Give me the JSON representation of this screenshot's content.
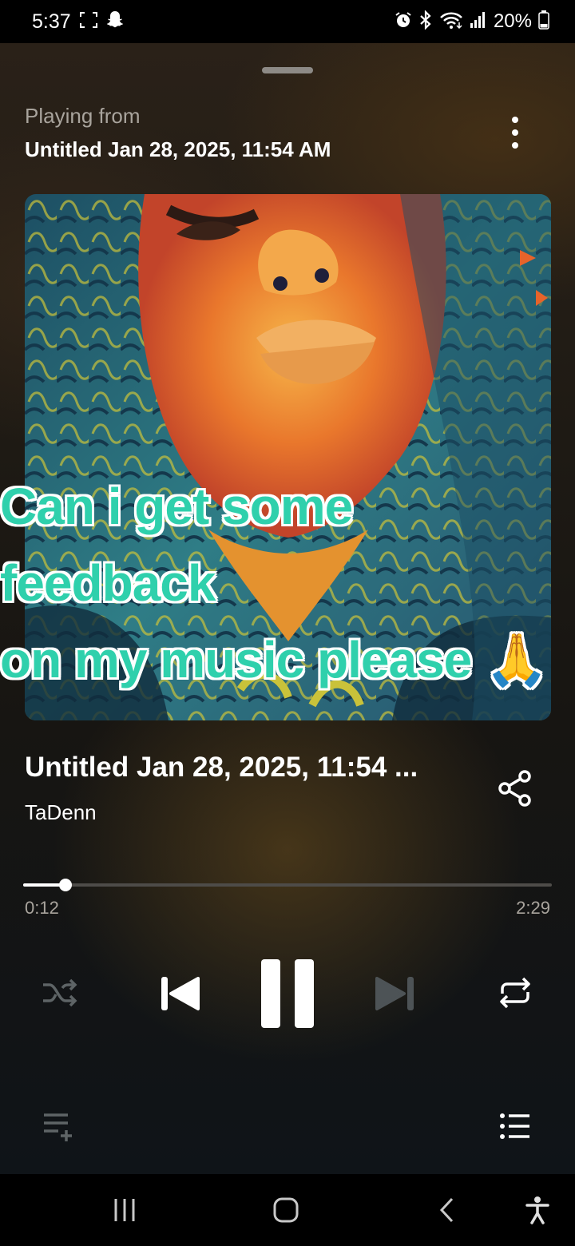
{
  "status_bar": {
    "time": "5:37",
    "battery": "20%",
    "icons": [
      "screenshot-icon",
      "snapchat-icon",
      "alarm-icon",
      "bluetooth-icon",
      "wifi-icon",
      "signal-icon",
      "battery-icon"
    ]
  },
  "header": {
    "playing_from_label": "Playing from",
    "playing_from_title": "Untitled Jan 28, 2025, 11:54 AM"
  },
  "overlay": {
    "caption": "Can i get some feedback\non my music please 🙏"
  },
  "track": {
    "title": "Untitled Jan 28, 2025, 11:54 ...",
    "artist": "TaDenn"
  },
  "playback": {
    "elapsed": "0:12",
    "duration": "2:29",
    "progress_fraction": 0.0805
  },
  "controls": [
    "shuffle-icon",
    "previous-icon",
    "pause-icon",
    "next-icon",
    "repeat-icon",
    "add-to-queue-icon",
    "queue-list-icon"
  ],
  "nav": [
    "recent-apps-icon",
    "home-icon",
    "back-icon",
    "accessibility-icon"
  ],
  "colors": {
    "caption": "#2fd0ac",
    "accent": "#ffffff",
    "muted_text": "#a9a49d"
  }
}
